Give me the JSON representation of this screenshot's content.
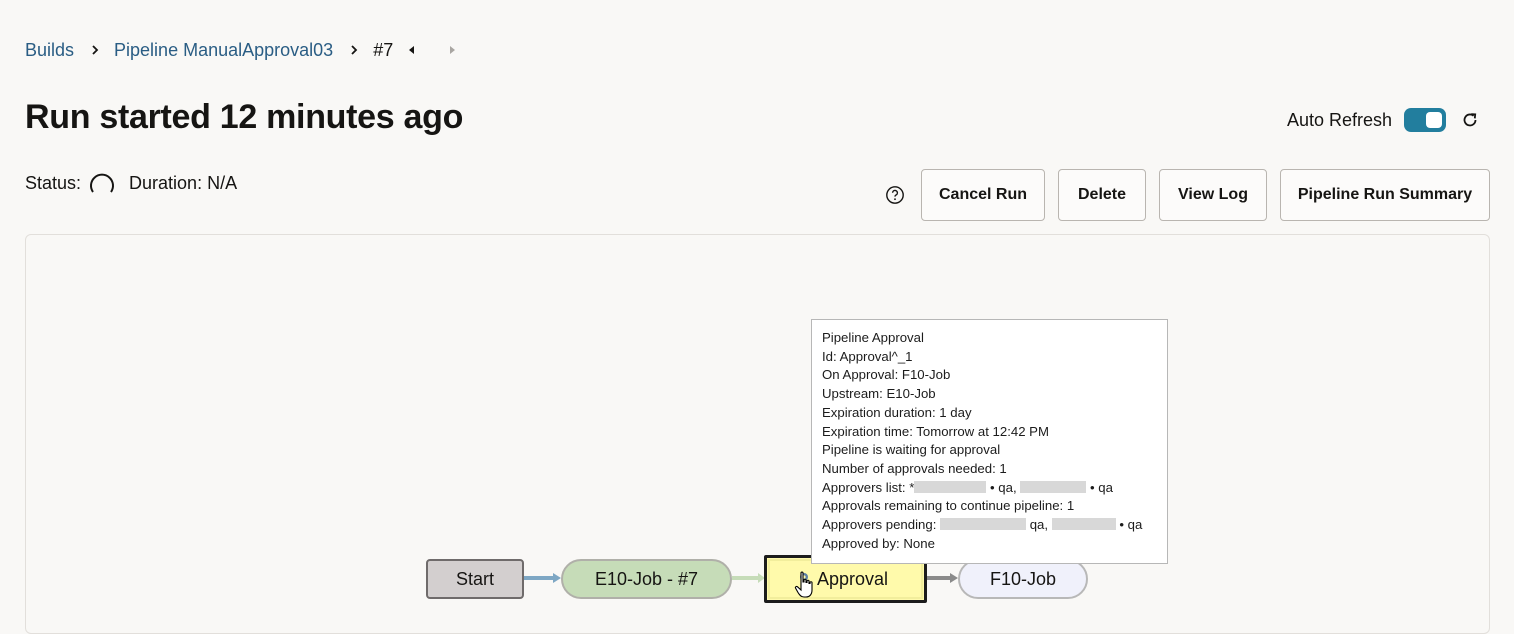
{
  "breadcrumb": {
    "builds": "Builds",
    "pipeline": "Pipeline ManualApproval03",
    "run": "#7"
  },
  "header": {
    "title": "Run started 12 minutes ago",
    "auto_refresh_label": "Auto Refresh",
    "auto_refresh_on": true
  },
  "status": {
    "status_label": "Status:",
    "duration_label": "Duration: N/A"
  },
  "toolbar": {
    "cancel_run": "Cancel Run",
    "delete": "Delete",
    "view_log": "View Log",
    "pipeline_run_summary": "Pipeline Run Summary"
  },
  "pipeline": {
    "nodes": {
      "start": "Start",
      "e10": "E10-Job - #7",
      "approval": "Approval",
      "f10": "F10-Job"
    }
  },
  "tooltip": {
    "title": "Pipeline Approval",
    "id": "Id: Approval^_1",
    "on_approval": "On Approval: F10-Job",
    "upstream": "Upstream: E10-Job",
    "expiration_duration": "Expiration duration: 1 day",
    "expiration_time": "Expiration time: Tomorrow at 12:42 PM",
    "waiting": "Pipeline is waiting for approval",
    "approvals_needed": "Number of approvals needed: 1",
    "approvers_list_label": "Approvers list: *",
    "approvers_list_sep": " • qa, ",
    "approvers_list_end": " • qa",
    "approvals_remaining": "Approvals remaining to continue pipeline: 1",
    "approvers_pending_label": "Approvers pending: ",
    "approvers_pending_sep": " qa, ",
    "approvers_pending_end": " • qa",
    "approved_by": "Approved by: None"
  },
  "colors": {
    "link": "#2a5d84",
    "toggle_on": "#227e9e",
    "start_fill": "#d3cfcf",
    "e10_fill": "#c6dcb8",
    "approval_fill": "#fffaab",
    "f10_fill": "#f0f1fb"
  },
  "icons": {
    "breadcrumb_separator": "chevron-right-icon",
    "prev_run": "caret-left-icon",
    "next_run": "caret-right-icon",
    "refresh": "refresh-icon",
    "status": "spinner-icon",
    "help": "help-icon",
    "approval": "approval-gear-icon",
    "cursor": "hand-pointer-icon"
  }
}
